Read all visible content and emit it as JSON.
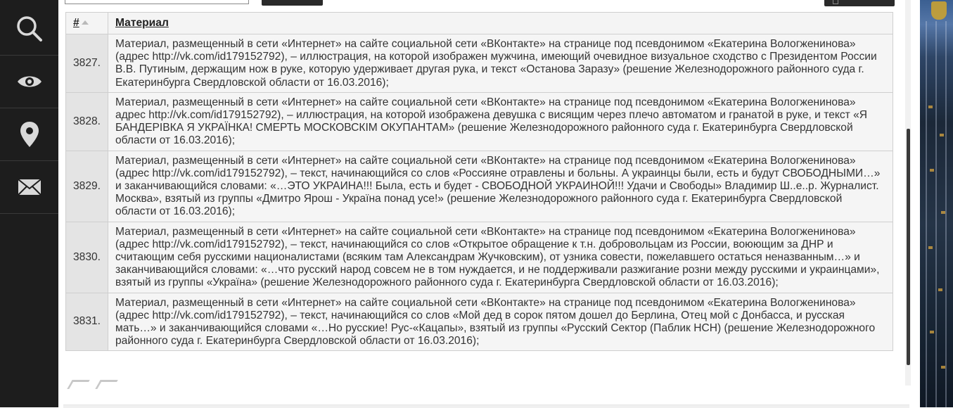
{
  "sidebar": {
    "items": [
      {
        "icon": "search-icon"
      },
      {
        "icon": "eye-icon"
      },
      {
        "icon": "map-pin-icon"
      },
      {
        "icon": "envelope-icon"
      }
    ]
  },
  "table": {
    "headers": {
      "num": "#",
      "material": "Материал"
    },
    "rows": [
      {
        "num": "3827.",
        "text": "Материал, размещенный в сети «Интернет» на сайте социальной сети «ВКонтакте» на странице под псевдонимом «Екатерина Вологженинова» (адрес http://vk.com/id179152792), – иллюстрация, на которой изображен мужчина, имеющий очевидное визуальное сходство с Президентом России В.В. Путиным, держащим нож в руке, которую удерживает другая рука, и текст «Останова Заразу» (решение Железнодорожного районного суда г. Екатеринбурга Свердловской области от 16.03.2016);"
      },
      {
        "num": "3828.",
        "text": "Материал, размещенный в сети «Интернет» на сайте социальной сети «ВКонтакте» на странице под псевдонимом «Екатерина Вологженинова» адрес http://vk.com/id179152792), – иллюстрация, на которой изображена девушка с висящим через плечо автоматом и гранатой в руке, и текст «Я БАНДЕРІВКА Я УКРАЇНКА! СМЕРТЬ МОСКОВСКІМ ОКУПАНТАМ» (решение Железнодорожного районного суда г. Екатеринбурга Свердловской области от 16.03.2016);"
      },
      {
        "num": "3829.",
        "text": "Материал, размещенный в сети «Интернет» на сайте социальной сети «ВКонтакте» на странице под псевдонимом «Екатерина Вологженинова» (адрес http://vk.com/id179152792), – текст, начинающийся со слов «Россияне отравлены и больны. А украинцы были, есть и будут СВОБОДНЫМИ…» и заканчивающийся словами: «…ЭТО УКРАИНА!!! Была, есть и будет - СВОБОДНОЙ УКРАИНОЙ!!! Удачи и Свободы» Владимир Ш..е..р. Журналист. Москва», взятый из группы «Дмитро Ярош - Україна понад усе!» (решение Железнодорожного районного суда г. Екатеринбурга Свердловской области от 16.03.2016);"
      },
      {
        "num": "3830.",
        "text": "Материал, размещенный в сети «Интернет» на сайте социальной сети «ВКонтакте» на странице под псевдонимом «Екатерина Вологженинова» (адрес http://vk.com/id179152792), – текст, начинающийся со слов «Открытое обращение к т.н. добровольцам из России, воюющим за ДНР и считающим себя русскими националистами (всяким там Александрам Жучковским), от узника совести, пожелавшего остаться неназванным…» и заканчивающийся словами: «…что русский народ совсем не в том нуждается, и не поддерживали разжигание розни между русскими и украинцами», взятый из группы «Украïна» (решение Железнодорожного районного суда г. Екатеринбурга Свердловской области от 16.03.2016);"
      },
      {
        "num": "3831.",
        "text": "Материал, размещенный в сети «Интернет» на сайте социальной сети «ВКонтакте» на странице под псевдонимом «Екатерина Вологженинова» (адрес http://vk.com/id179152792), – текст, начинающийся со слов «Мой дед в сорок пятом дошел до Берлина, Отец мой с Донбасса, и русская мать…» и заканчивающийся словами «…Но русские! Рус-«Кацапы», взятый из группы «Русский Сектор (Паблик НСН) (решение Железнодорожного районного суда г. Екатеринбурга Свердловской области от 16.03.2016);"
      }
    ]
  },
  "colors": {
    "sidebar_bg": "#1d1d1d",
    "icon": "#d9d9d9",
    "num_cell_bg": "#e4e4e4",
    "text_cell_bg": "#f5f5f5"
  }
}
